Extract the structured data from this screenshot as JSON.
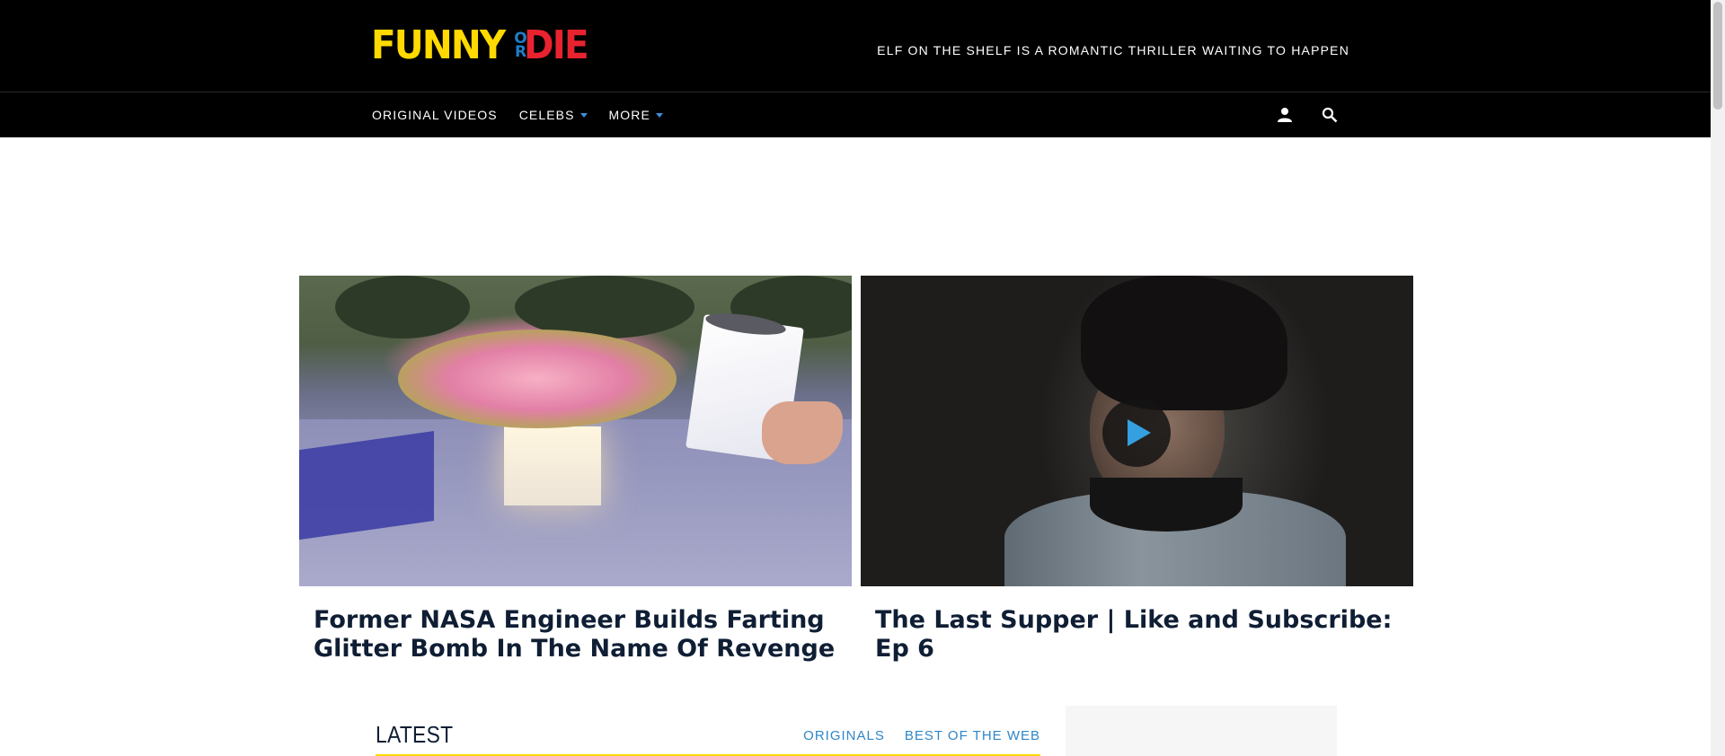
{
  "header": {
    "logo": {
      "funny": "FUNNY",
      "or_top": "O",
      "or_bottom": "R",
      "die": "DIE"
    },
    "promo_text": "ELF ON THE SHELF IS A ROMANTIC THRILLER WAITING TO HAPPEN"
  },
  "nav": {
    "items": [
      {
        "label": "ORIGINAL VIDEOS",
        "has_dropdown": false
      },
      {
        "label": "CELEBS",
        "has_dropdown": true
      },
      {
        "label": "MORE",
        "has_dropdown": true
      }
    ],
    "icons": [
      "user-icon",
      "search-icon"
    ]
  },
  "featured": [
    {
      "title": "Former NASA Engineer Builds Farting Glitter Bomb In The Name Of Revenge",
      "has_video": false
    },
    {
      "title": "The Last Supper | Like and Subscribe: Ep 6",
      "has_video": true
    }
  ],
  "latest": {
    "title": "LATEST",
    "tabs": [
      "ORIGINALS",
      "BEST OF THE WEB"
    ]
  },
  "colors": {
    "logo_yellow": "#ffd900",
    "logo_red": "#e8232f",
    "logo_blue": "#1e7ec8",
    "accent_blue": "#2f86c8",
    "headline_navy": "#0f1e34"
  }
}
